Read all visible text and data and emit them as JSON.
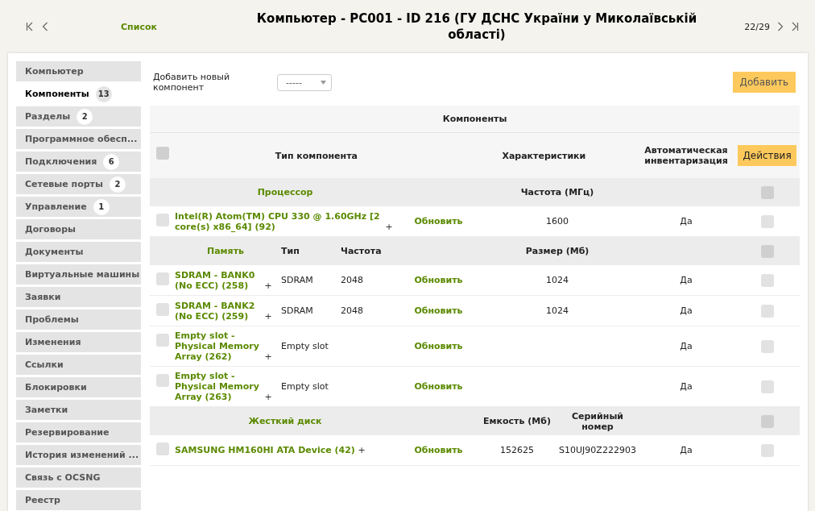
{
  "header": {
    "list_link": "Список",
    "title": "Компьютер - PC001 - ID 216 (ГУ ДСНС України у Миколаївській області)",
    "counter": "22/29"
  },
  "sidebar": {
    "items": [
      {
        "label": "Компьютер",
        "selected": false
      },
      {
        "label": "Компоненты",
        "count": "13",
        "selected": true
      },
      {
        "label": "Разделы",
        "count": "2",
        "selected": false
      },
      {
        "label": "Программное обесп...",
        "selected": false
      },
      {
        "label": "Подключения",
        "count": "6",
        "selected": false
      },
      {
        "label": "Сетевые порты",
        "count": "2",
        "selected": false
      },
      {
        "label": "Управление",
        "count": "1",
        "selected": false
      },
      {
        "label": "Договоры",
        "selected": false
      },
      {
        "label": "Документы",
        "selected": false
      },
      {
        "label": "Виртуальные машины",
        "selected": false
      },
      {
        "label": "Заявки",
        "selected": false
      },
      {
        "label": "Проблемы",
        "selected": false
      },
      {
        "label": "Изменения",
        "selected": false
      },
      {
        "label": "Ссылки",
        "selected": false
      },
      {
        "label": "Блокировки",
        "selected": false
      },
      {
        "label": "Заметки",
        "selected": false
      },
      {
        "label": "Резервирование",
        "selected": false
      },
      {
        "label": "История изменений ...",
        "selected": false
      },
      {
        "label": "Связь с OCSNG",
        "selected": false
      },
      {
        "label": "Реестр",
        "selected": false
      }
    ]
  },
  "add_form": {
    "label": "Добавить новый компонент",
    "select_value": "-----",
    "button": "Добавить"
  },
  "table": {
    "title": "Компоненты",
    "select_all_checked": false,
    "columns": [
      "Тип компонента",
      "Характеристики",
      "Автоматическая инвентаризация"
    ],
    "actions_button": "Действия",
    "groups": [
      {
        "label": "Процессор",
        "columns_after": [
          "Частота (МГц)"
        ],
        "checked": false,
        "items": [
          {
            "name": "Intel(R) Atom(TM) CPU 330 @ 1.60GHz [2 core(s) x86_64] (92)",
            "expand_sign": "+",
            "update": "Обновить",
            "after": [
              "1600"
            ],
            "auto": "Да",
            "checked": false
          }
        ]
      },
      {
        "label": "Память",
        "columns_before": [
          "Тип",
          "Частота"
        ],
        "columns_after": [
          "Размер (Мб)"
        ],
        "checked": false,
        "items": [
          {
            "name": "SDRAM - BANK0 (No ECC) (258)",
            "expand_sign": "+",
            "before": [
              "SDRAM",
              "2048"
            ],
            "update": "Обновить",
            "after": [
              "1024"
            ],
            "auto": "Да",
            "checked": false
          },
          {
            "name": "SDRAM - BANK2 (No ECC) (259)",
            "expand_sign": "+",
            "before": [
              "SDRAM",
              "2048"
            ],
            "update": "Обновить",
            "after": [
              "1024"
            ],
            "auto": "Да",
            "checked": false
          },
          {
            "name": "Empty slot - Physical Memory Array (262)",
            "expand_sign": "+",
            "before": [
              "Empty slot"
            ],
            "update": "Обновить",
            "auto": "Да",
            "checked": false
          },
          {
            "name": "Empty slot - Physical Memory Array (263)",
            "expand_sign": "+",
            "before": [
              "Empty slot"
            ],
            "update": "Обновить",
            "auto": "Да",
            "checked": false
          }
        ]
      },
      {
        "label": "Жесткий диск",
        "columns_after": [
          "Емкость (Мб)",
          "Серийный номер"
        ],
        "checked": false,
        "items": [
          {
            "name": "SAMSUNG HM160HI ATA Device (42)",
            "expand_sign": "+",
            "update": "Обновить",
            "after": [
              "152625",
              "S10UJ90Z222903"
            ],
            "auto": "Да",
            "checked": false
          }
        ]
      }
    ]
  }
}
